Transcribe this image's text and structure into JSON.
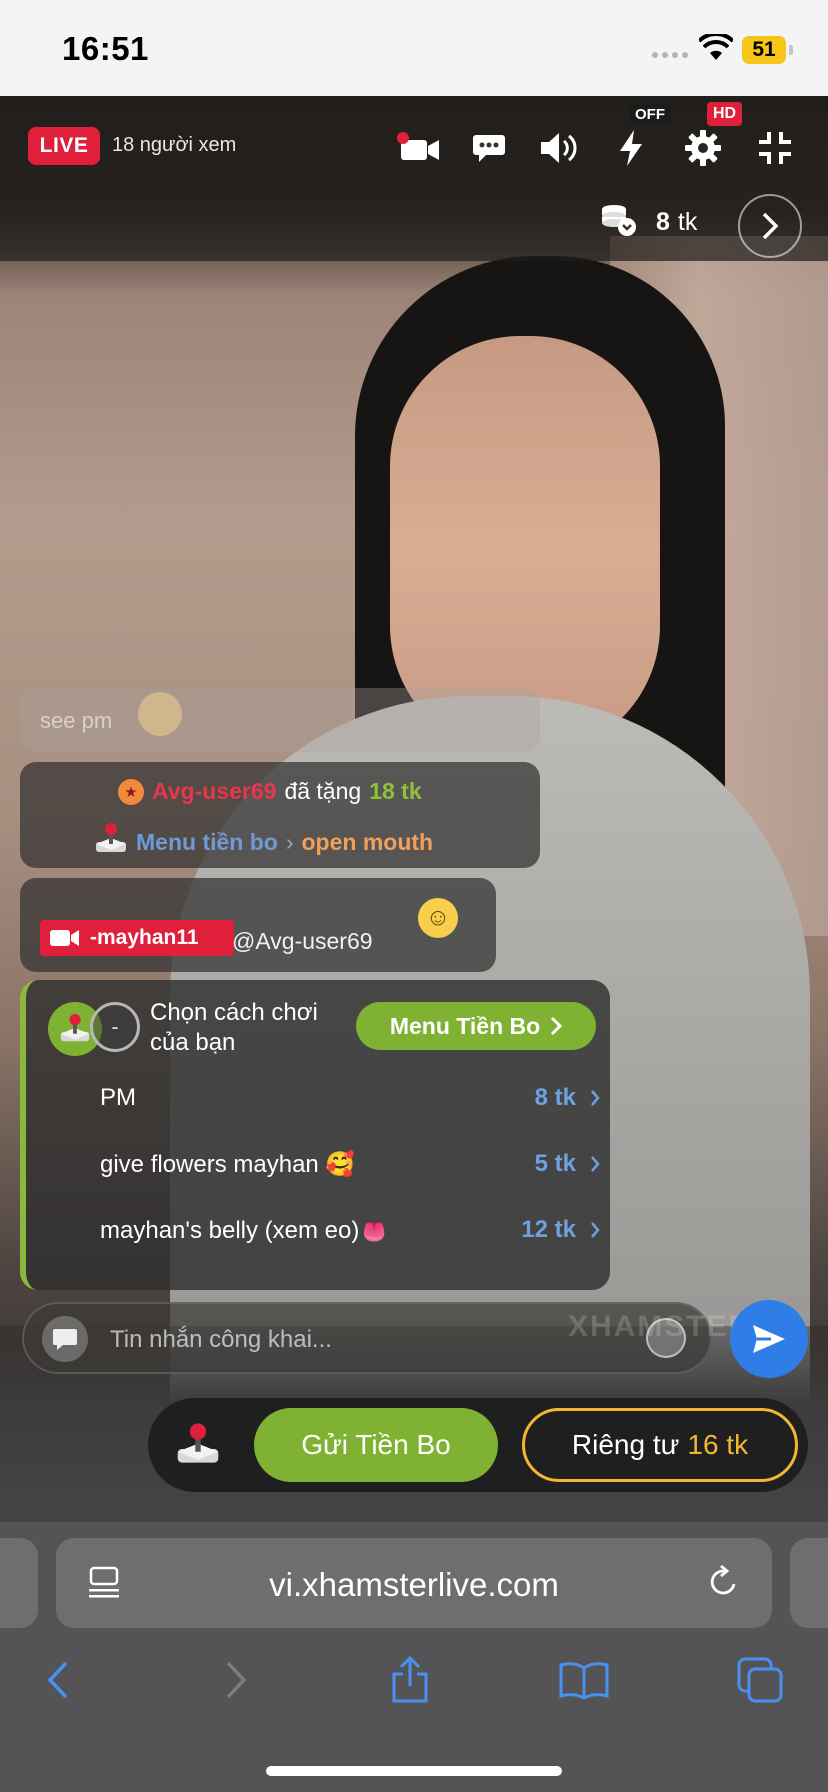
{
  "status_bar": {
    "time": "16:51",
    "battery": "51"
  },
  "header": {
    "live_label": "LIVE",
    "viewers": "18 người xem",
    "flash_badge": "OFF",
    "quality_badge": "HD",
    "coins_value": "8",
    "coins_unit": "tk",
    "icons": [
      "camera-icon",
      "chat-icon",
      "volume-icon",
      "flash-icon",
      "gear-icon",
      "collapse-icon"
    ]
  },
  "chat": {
    "faded_message": "see pm",
    "tip_message": {
      "user": "Avg-user69",
      "action": "đã tặng",
      "amount": "18 tk",
      "menu_label": "Menu tiền bo",
      "item": "open mouth"
    },
    "mention_message": {
      "host": "-mayhan11",
      "text": "@Avg-user69",
      "emoji": "☺"
    }
  },
  "tip_menu": {
    "dash": "-",
    "title": "Chọn cách chơi của bạn",
    "button_label": "Menu Tiền Bo",
    "items": [
      {
        "label": "PM",
        "price": "8 tk"
      },
      {
        "label": "give flowers mayhan 🥰",
        "price": "5 tk"
      },
      {
        "label": "mayhan's belly (xem eo)👅",
        "price": "12 tk"
      }
    ]
  },
  "input": {
    "placeholder": "Tin nhắn công khai...",
    "watermark": "XHAMSTER"
  },
  "actions": {
    "tip_button": "Gửi Tiền Bo",
    "private_label": "Riêng tư",
    "private_price": "16 tk"
  },
  "browser": {
    "url": "vi.xhamsterlive.com"
  },
  "colors": {
    "live_red": "#e0203a",
    "accent_green": "#7fb232",
    "gold": "#f2b632",
    "link_blue": "#6fa0e0"
  }
}
